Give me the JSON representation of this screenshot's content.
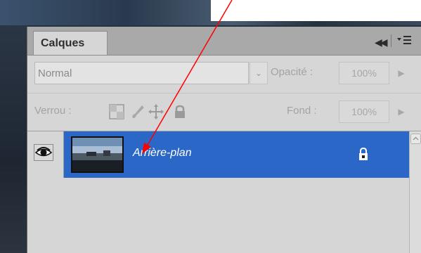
{
  "panel": {
    "tab_label": "Calques",
    "collapse_icon": "double-left-chevron-icon",
    "menu_icon": "panel-menu-icon"
  },
  "blend": {
    "mode": "Normal",
    "opacity_label": "Opacité :",
    "opacity_value": "100%"
  },
  "lock": {
    "label": "Verrou :",
    "fill_label": "Fond :",
    "fill_value": "100%",
    "icons": [
      "lock-transparency-icon",
      "lock-brush-icon",
      "lock-move-icon",
      "lock-all-icon"
    ]
  },
  "layers": [
    {
      "name": "Arrière-plan",
      "visible": true,
      "locked": true,
      "selected": true
    }
  ],
  "colors": {
    "selected_row": "#2a67c6",
    "annotation_arrow": "#ff0000"
  }
}
